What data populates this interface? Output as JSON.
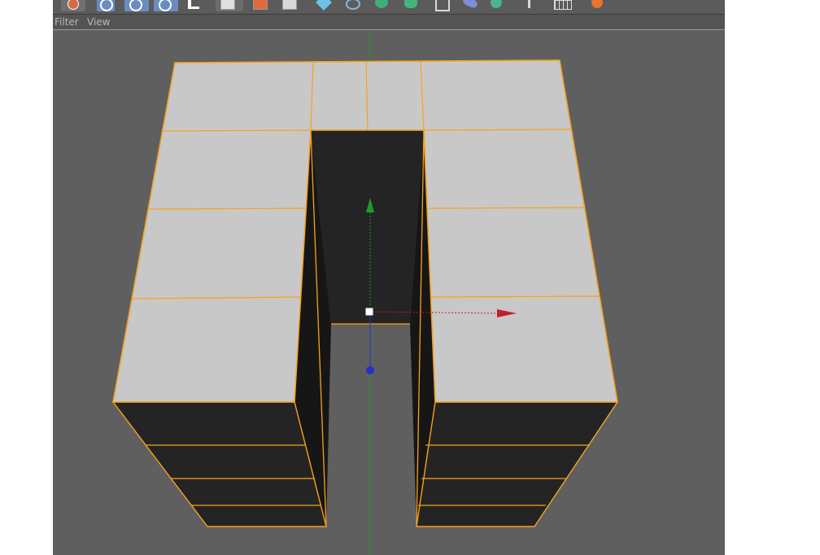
{
  "menubar": {
    "items": [
      "Filter",
      "View"
    ]
  },
  "toolbar": {
    "groups": [
      {
        "name": "live-selection",
        "icons": [
          "undo-selection-icon"
        ]
      },
      {
        "name": "axis-lock",
        "icons": [
          "x-axis-icon",
          "y-axis-icon",
          "z-axis-icon",
          "coordinate-system-icon"
        ]
      },
      {
        "name": "mode",
        "icons": [
          "model-mode-icon",
          "object-mode-icon",
          "texture-mode-icon"
        ]
      },
      {
        "name": "create",
        "icons": [
          "cube-icon",
          "spline-pen-icon",
          "nurbs-icon",
          "array-icon",
          "deformer-icon",
          "scene-icon",
          "camera-icon"
        ]
      },
      {
        "name": "render",
        "icons": [
          "light-icon",
          "floor-icon",
          "render-icon"
        ]
      }
    ]
  },
  "colors": {
    "viewport_bg": "#5f5f5f",
    "top_face": "#c8c8c8",
    "side_face": "#242424",
    "edge_highlight": "#f7a21b",
    "axis_x": "#c0202a",
    "axis_y": "#1f9a2a",
    "axis_z": "#2233c8"
  }
}
